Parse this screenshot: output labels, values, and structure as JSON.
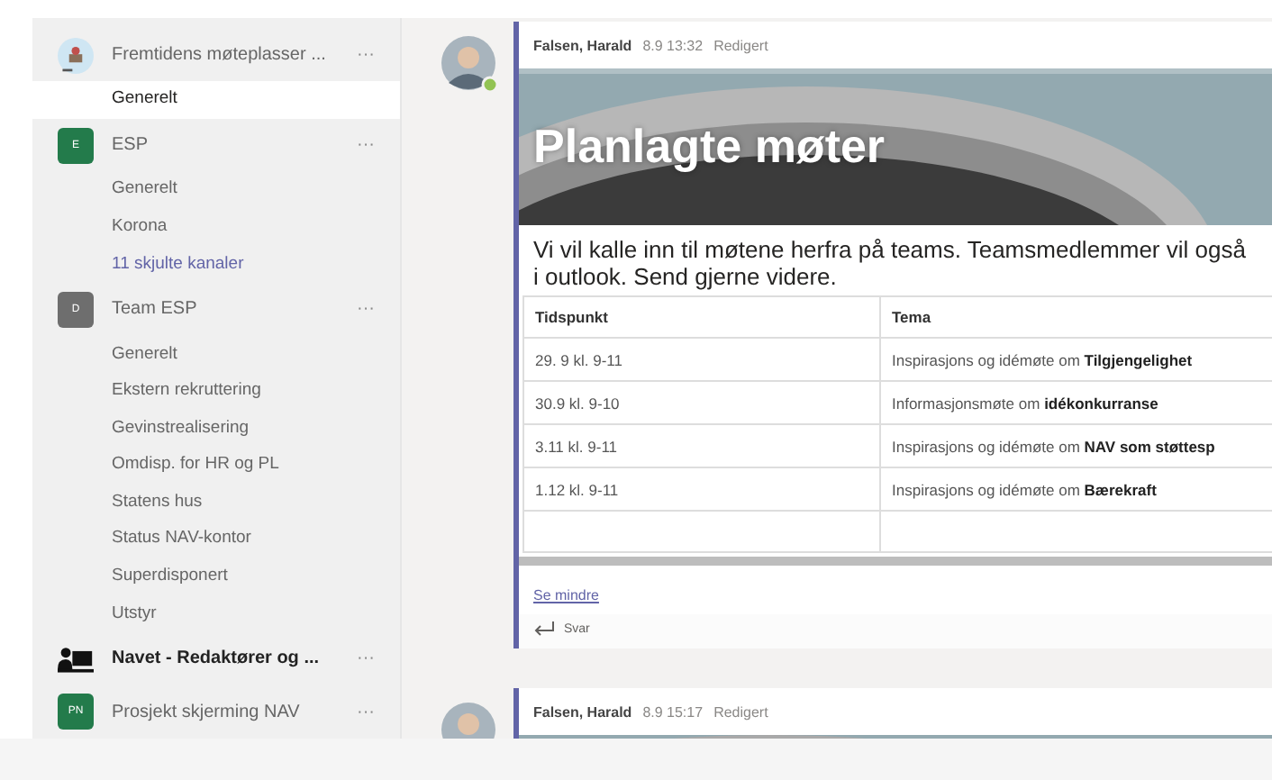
{
  "sidebar": {
    "teams": [
      {
        "name": "Fremtidens møteplasser ...",
        "more": "···",
        "bold": false,
        "channels": [
          {
            "name": "Generelt",
            "selected": true
          }
        ]
      },
      {
        "name": "ESP",
        "kind": "letter",
        "avatar_text": "E",
        "color": "#237b4b",
        "more": "···",
        "bold": false,
        "channels": [
          {
            "name": "Generelt",
            "selected": false
          },
          {
            "name": "Korona",
            "selected": false
          }
        ],
        "hidden_channels": "11 skjulte kanaler"
      },
      {
        "name": "Team ESP",
        "kind": "letter",
        "avatar_text": "D",
        "color": "#6e6e6e",
        "more": "···",
        "bold": false,
        "channels": [
          {
            "name": "Generelt",
            "selected": false
          },
          {
            "name": "Ekstern rekruttering",
            "selected": false
          },
          {
            "name": "Gevinstrealisering",
            "selected": false
          },
          {
            "name": "Omdisp. for HR og PL",
            "selected": false
          },
          {
            "name": "Statens hus",
            "selected": false
          },
          {
            "name": "Status NAV-kontor",
            "selected": false
          },
          {
            "name": "Superdisponert",
            "selected": false
          },
          {
            "name": "Utstyr",
            "selected": false
          }
        ]
      },
      {
        "name": "Navet - Redaktører og ...",
        "kind": "device",
        "more": "···",
        "bold": true
      },
      {
        "name": "Prosjekt skjerming NAV",
        "kind": "letter",
        "avatar_text": "PN",
        "color": "#237b4b",
        "more": "···",
        "bold": false
      }
    ]
  },
  "messages": [
    {
      "author": "Falsen, Harald",
      "time": "8.9 13:32",
      "edited": "Redigert",
      "banner_title": "Planlagte møter",
      "lines": [
        "Vi vil kalle inn til møtene herfra på teams. Teamsmedlemmer vil også",
        "i outlook. Send gjerne videre."
      ],
      "table": {
        "columns": [
          "Tidspunkt",
          "Tema"
        ],
        "rows": [
          [
            "29. 9 kl. 9-11",
            "Inspirasjons og idémøte om **Tilgjengelighet**"
          ],
          [
            "30.9 kl. 9-10",
            "Informasjonsmøte om **idékonkurranse**"
          ],
          [
            "3.11 kl. 9-11",
            "Inspirasjons og idémøte om **NAV som støttesp**"
          ],
          [
            "1.12 kl. 9-11",
            "Inspirasjons og idémøte om **Bærekraft**"
          ]
        ]
      },
      "toggle": "Se mindre",
      "reply": "Svar"
    },
    {
      "author": "Falsen, Harald",
      "time": "8.9 15:17",
      "edited": "Redigert"
    }
  ]
}
